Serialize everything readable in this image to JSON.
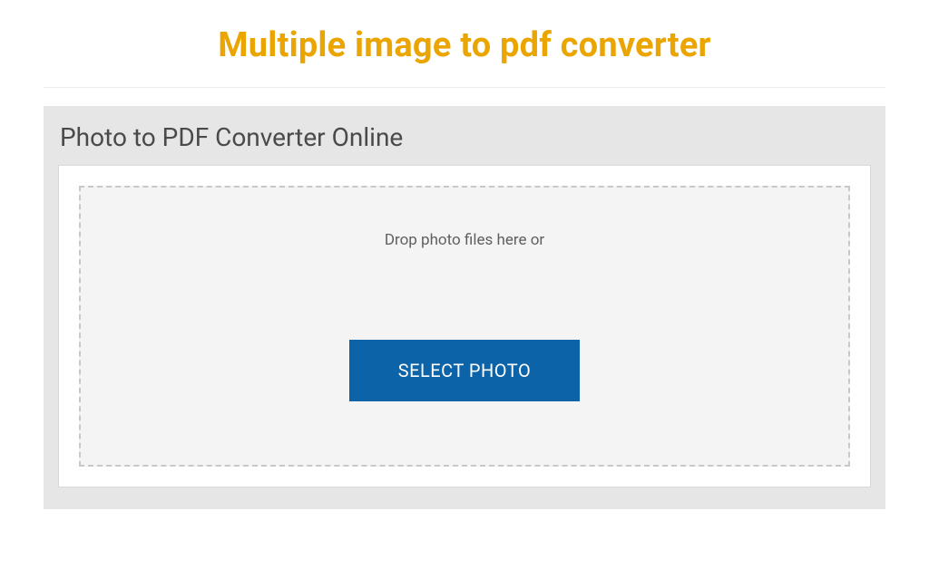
{
  "header": {
    "title": "Multiple image to pdf converter"
  },
  "panel": {
    "heading": "Photo to PDF Converter Online"
  },
  "dropzone": {
    "instruction": "Drop photo files here or",
    "button_label": "SELECT PHOTO"
  },
  "colors": {
    "accent_title": "#EBA500",
    "button_bg": "#0c63a8",
    "panel_bg": "#e6e6e6",
    "dropzone_bg": "#f4f4f4"
  }
}
